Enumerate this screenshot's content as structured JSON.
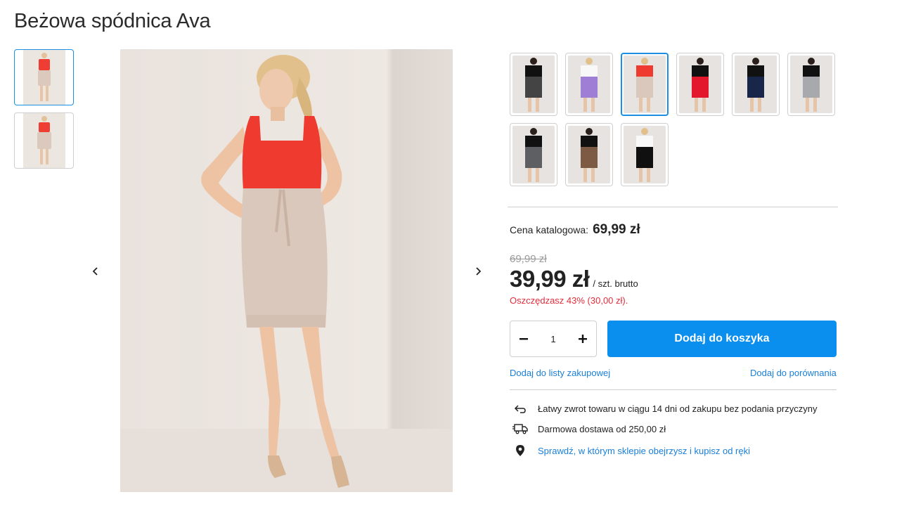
{
  "product": {
    "title": "Beżowa spódnica Ava"
  },
  "gallery": {
    "prev_icon": "chevron-left-icon",
    "next_icon": "chevron-right-icon"
  },
  "pricing": {
    "catalog_label": "Cena katalogowa:",
    "catalog_value": "69,99 zł",
    "old_price": "69,99 zł",
    "price": "39,99 zł",
    "unit": "/ szt. brutto",
    "savings": "Oszczędzasz 43% (30,00 zł).",
    "savings_color": "#e02d3c"
  },
  "cart": {
    "quantity": "1",
    "minus_label": "−",
    "plus_label": "+",
    "add_label": "Dodaj do koszyka",
    "accent": "#0a8fef"
  },
  "links": {
    "shopping_list": "Dodaj do listy zakupowej",
    "compare": "Dodaj do porównania"
  },
  "info": [
    {
      "icon": "return-arrow-icon",
      "text": "Łatwy zwrot towaru w ciągu 14 dni od zakupu bez podania przyczyny"
    },
    {
      "icon": "delivery-truck-icon",
      "text": "Darmowa dostawa od 250,00 zł"
    },
    {
      "icon": "location-pin-icon",
      "text": "Sprawdź, w którym sklepie obejrzysz i kupisz od ręki"
    }
  ]
}
